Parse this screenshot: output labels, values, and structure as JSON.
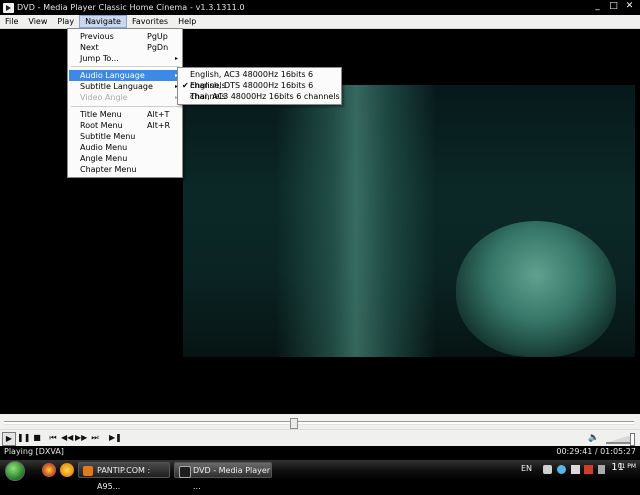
{
  "window": {
    "title": "DVD - Media Player Classic Home Cinema - v1.3.1311.0",
    "minimize": "_",
    "maximize": "□",
    "close": "✕"
  },
  "menubar": [
    "File",
    "View",
    "Play",
    "Navigate",
    "Favorites",
    "Help"
  ],
  "navigate_menu": {
    "previous": {
      "label": "Previous",
      "shortcut": "PgUp"
    },
    "next": {
      "label": "Next",
      "shortcut": "PgDn"
    },
    "jump_to": {
      "label": "Jump To...",
      "arrow": "▸"
    },
    "audio_language": {
      "label": "Audio Language",
      "arrow": "▸"
    },
    "subtitle_language": {
      "label": "Subtitle Language",
      "arrow": "▸"
    },
    "video_angle": {
      "label": "Video Angle",
      "arrow": "▸"
    },
    "title_menu": {
      "label": "Title Menu",
      "shortcut": "Alt+T"
    },
    "root_menu": {
      "label": "Root Menu",
      "shortcut": "Alt+R"
    },
    "subtitle_menu": {
      "label": "Subtitle Menu"
    },
    "audio_menu": {
      "label": "Audio Menu"
    },
    "angle_menu": {
      "label": "Angle Menu"
    },
    "chapter_menu": {
      "label": "Chapter Menu"
    }
  },
  "audio_submenu": [
    {
      "label": "English, AC3 48000Hz 16bits 6 channels",
      "checked": false
    },
    {
      "label": "English, DTS 48000Hz 16bits 6 channels",
      "checked": true,
      "check": "✔"
    },
    {
      "label": "Thai, AC3 48000Hz 16bits 6 channels",
      "checked": false
    }
  ],
  "playback": {
    "seek_fraction": 0.46,
    "volume_fraction": 0.92
  },
  "controls": {
    "play": "▶",
    "pause": "❚❚",
    "stop": "■",
    "prev": "⏮",
    "rewind": "◀◀",
    "forward": "▶▶",
    "next": "⏭",
    "frame_step": "▶❚",
    "volume_icon": "🔈"
  },
  "status": {
    "state": "Playing [DXVA]",
    "time": "00:29:41 / 01:05:27"
  },
  "taskbar": {
    "tasks": [
      {
        "label": "PANTIP.COM : A95...",
        "icon_color": "#e07a1d"
      },
      {
        "label": "DVD - Media Player ...",
        "icon_color": "#2a2a2a"
      }
    ],
    "lang": "EN",
    "clock": "11",
    "clock_suffix": "01 PM"
  },
  "colors": {
    "menu_highlight": "#3a8ae6",
    "accent_video": "#3f8675"
  }
}
